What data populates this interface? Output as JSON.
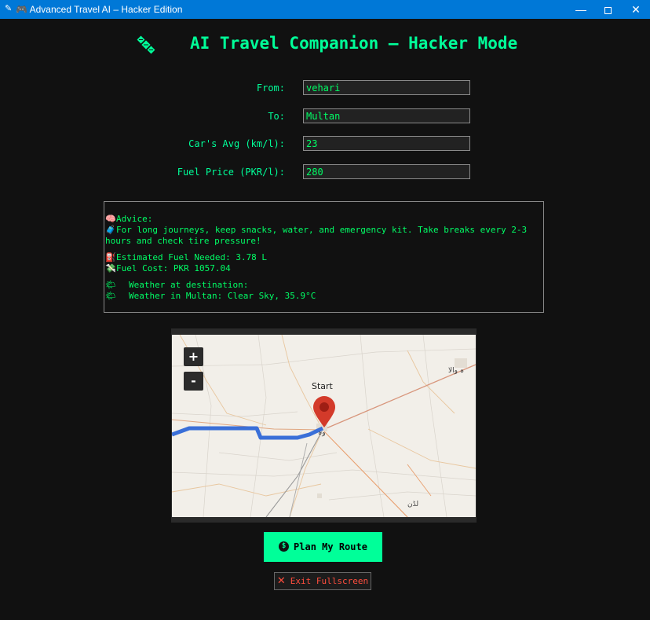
{
  "window": {
    "title": "🎮 Advanced Travel AI – Hacker Edition",
    "app_icon": "✎",
    "min_label": "—",
    "close_label": "✕"
  },
  "header": {
    "title": "AI Travel Companion – Hacker Mode",
    "icon": "satellite-icon"
  },
  "form": {
    "from_label": "From:",
    "from_value": "vehari",
    "to_label": "To:",
    "to_value": "Multan",
    "avg_label": "Car's Avg (km/l):",
    "avg_value": "23",
    "price_label": "Fuel Price (PKR/l):",
    "price_value": "280"
  },
  "output": {
    "advice_icon": "🧠",
    "advice_label": "Advice:",
    "tip_icon": "🧳",
    "tip_text": "For long journeys, keep snacks, water, and emergency kit. Take breaks every 2-3 hours and check tire pressure!",
    "fuel_icon": "⛽",
    "fuel_text": "Estimated Fuel Needed: 3.78 L",
    "cost_icon": "💸",
    "cost_text": "Fuel Cost: PKR 1057.04",
    "weather_icon": "🌤",
    "weather_heading": "Weather at destination:",
    "weather_text": "Weather in Multan: Clear Sky, 35.9°C"
  },
  "map": {
    "zoom_in": "+",
    "zoom_out": "-",
    "start_label": "Start",
    "place_town": "وہ",
    "place_east": "ہ والا",
    "place_south": "لڈن",
    "route_color": "#3a6fd8",
    "marker_color": "#d33a2a"
  },
  "buttons": {
    "plan_icon": "$",
    "plan_label": "Plan My Route",
    "exit_icon": "✕",
    "exit_label": "Exit Fullscreen"
  },
  "colors": {
    "accent": "#00ff99",
    "text_green": "#00ff66",
    "danger": "#ff4d3d",
    "background": "#111111",
    "titlebar": "#0078d7"
  }
}
